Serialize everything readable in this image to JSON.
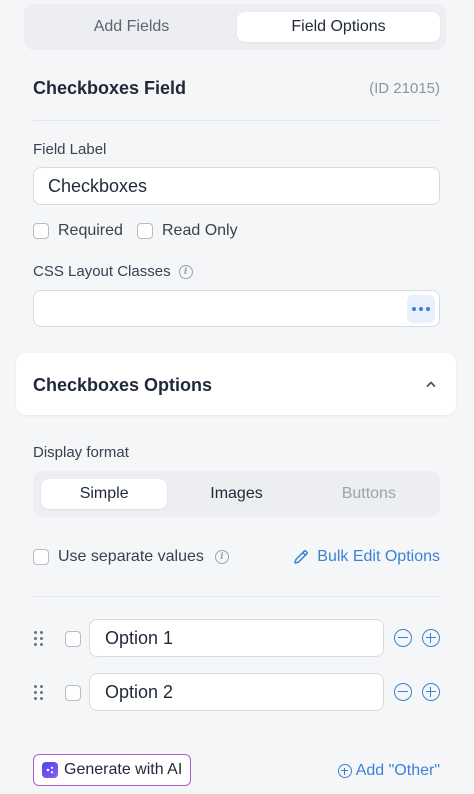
{
  "tabs": [
    {
      "label": "Add Fields",
      "active": false
    },
    {
      "label": "Field Options",
      "active": true
    }
  ],
  "field": {
    "title": "Checkboxes Field",
    "id_text": "(ID 21015)",
    "label_caption": "Field Label",
    "label_value": "Checkboxes",
    "required_label": "Required",
    "readonly_label": "Read Only",
    "css_caption": "CSS Layout Classes",
    "css_value": ""
  },
  "options_section": {
    "title": "Checkboxes Options",
    "display_format_caption": "Display format",
    "formats": [
      {
        "label": "Simple",
        "active": true
      },
      {
        "label": "Images",
        "active": false
      },
      {
        "label": "Buttons",
        "active": false,
        "muted": true
      }
    ],
    "separate_values_label": "Use separate values",
    "bulk_edit_label": "Bulk Edit Options",
    "options": [
      {
        "value": "Option 1"
      },
      {
        "value": "Option 2"
      }
    ],
    "generate_ai_label": "Generate with AI",
    "add_other_label": "Add \"Other\""
  },
  "colors": {
    "accent": "#3b82d6",
    "ai_border": "#b15ccf",
    "background": "#f5f6f8"
  },
  "icons": [
    "info-icon",
    "more-dots-icon",
    "chevron-up-icon",
    "pencil-icon",
    "drag-handle-icon",
    "minus-circle-icon",
    "plus-circle-icon",
    "ai-sparkle-icon"
  ]
}
